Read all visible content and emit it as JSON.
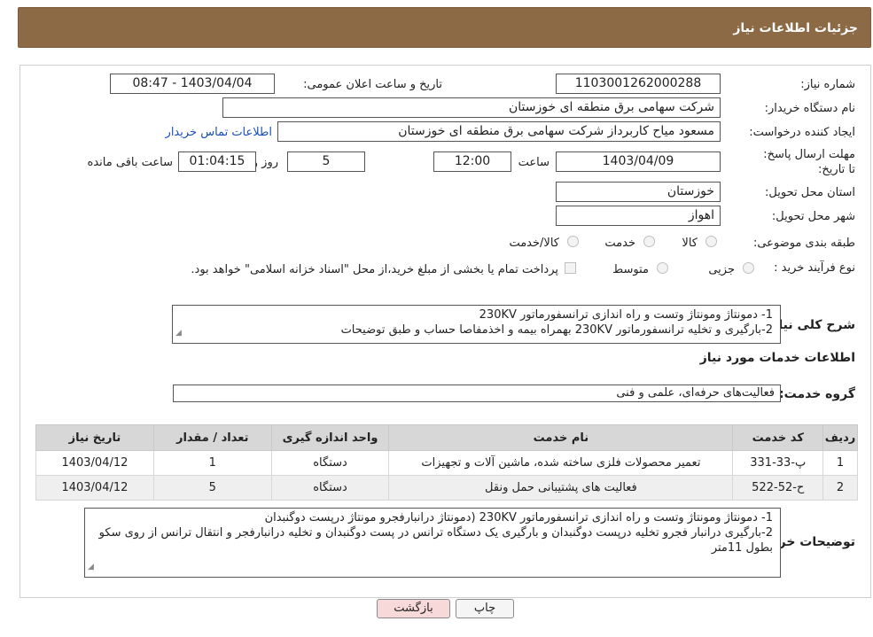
{
  "header": {
    "title": "جزئیات اطلاعات نیاز"
  },
  "form": {
    "need_number_label": "شماره نیاز:",
    "need_number": "1103001262000288",
    "announce_label": "تاریخ و ساعت اعلان عمومی:",
    "announce_value": "1403/04/04 - 08:47",
    "buyer_org_label": "نام دستگاه خریدار:",
    "buyer_org": "شرکت سهامی برق منطقه ای خوزستان",
    "requester_label": "ایجاد کننده درخواست:",
    "requester": "مسعود میاح کاربرداز شرکت سهامی برق منطقه ای خوزستان",
    "contact_link": "اطلاعات تماس خریدار",
    "deadline_label": "مهلت ارسال پاسخ: تا تاریخ:",
    "deadline_date": "1403/04/09",
    "time_label": "ساعت",
    "deadline_time": "12:00",
    "days_value": "5",
    "days_label": "روز و",
    "remaining_time": "01:04:15",
    "remaining_label": "ساعت باقی مانده",
    "province_label": "استان محل تحویل:",
    "province": "خوزستان",
    "city_label": "شهر محل تحویل:",
    "city": "اهواز",
    "category_label": "طبقه بندی موضوعی:",
    "category_options": [
      "کالا",
      "خدمت",
      "کالا/خدمت"
    ],
    "purchase_type_label": "نوع فرآیند خرید :",
    "purchase_options": [
      "جزیی",
      "متوسط"
    ],
    "payment_note": "پرداخت تمام یا بخشی از مبلغ خرید،از محل \"اسناد خزانه اسلامی\" خواهد بود."
  },
  "summary": {
    "label": "شرح کلی نیاز:",
    "line1": "1- دمونتاژ ومونتاژ وتست و راه اندازی ترانسفورماتور 230KV",
    "line2": "2-بارگیری و تخلیه ترانسفورماتور 230KV  بهمراه بیمه و اخذمفاصا حساب و طبق توضیحات"
  },
  "services": {
    "section_title": "اطلاعات خدمات مورد نیاز",
    "group_label": "گروه خدمت:",
    "group_value": "فعالیت‌های حرفه‌ای، علمی و فنی",
    "columns": [
      "ردیف",
      "کد خدمت",
      "نام خدمت",
      "واحد اندازه گیری",
      "تعداد / مقدار",
      "تاریخ نیاز"
    ],
    "rows": [
      [
        "1",
        "پ-33-331",
        "تعمیر محصولات فلزی ساخته شده، ماشین آلات و تجهیزات",
        "دستگاه",
        "1",
        "1403/04/12"
      ],
      [
        "2",
        "ح-52-522",
        "فعالیت های پشتیبانی حمل ونقل",
        "دستگاه",
        "5",
        "1403/04/12"
      ]
    ]
  },
  "buyer_notes": {
    "label": "توضیحات خریدار:",
    "line1": "1- دمونتاژ ومونتاژ وتست و راه اندازی ترانسفورماتور 230KV (دمونتاژ درانبارفجرو مونتاژ درپست  دوگنبدان",
    "line2": "2-بارگیری درانبار فجرو تخلیه درپست دوگنبدان و بارگیری یک دستگاه ترانس در پست دوگنبدان و تخلیه درانبارفجر و انتقال ترانس از روی سکو بطول 11متر"
  },
  "buttons": {
    "print": "چاپ",
    "back": "بازگشت"
  },
  "colors": {
    "header_bg": "#8c6a45",
    "back_bg": "#f7d9d9",
    "link": "#1a50b5"
  }
}
